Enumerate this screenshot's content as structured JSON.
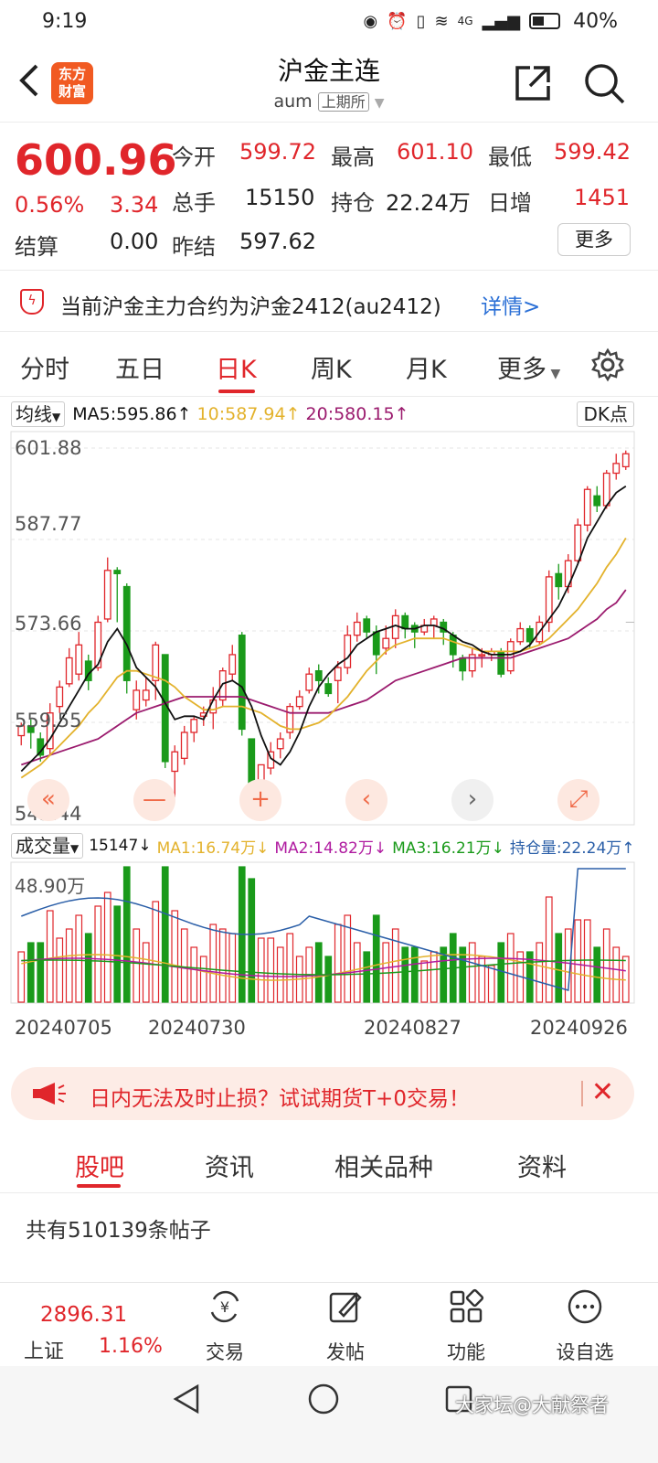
{
  "status": {
    "time": "9:19",
    "network": "4G",
    "battery": "40%"
  },
  "header": {
    "title": "沪金主连",
    "code": "aum",
    "exchange": "上期所",
    "logo_top": "东方",
    "logo_bottom": "财富"
  },
  "quote": {
    "price": "600.96",
    "change_pct": "0.56%",
    "change": "3.34",
    "settle_label": "结算",
    "settle": "0.00",
    "open_label": "今开",
    "open": "599.72",
    "high_label": "最高",
    "high": "601.10",
    "low_label": "最低",
    "low": "599.42",
    "volume_label": "总手",
    "volume": "15150",
    "oi_label": "持仓",
    "oi": "22.24万",
    "daily_inc_label": "日增",
    "daily_inc": "1451",
    "prev_settle_label": "昨结",
    "prev_settle": "597.62",
    "more_label": "更多"
  },
  "notice": {
    "text": "当前沪金主力合约为沪金2412(au2412)",
    "link": "详情>"
  },
  "tabs": [
    "分时",
    "五日",
    "日K",
    "周K",
    "月K",
    "更多"
  ],
  "ma": {
    "selector": "均线",
    "ma5": "MA5:595.86↑",
    "ma10": "10:587.94↑",
    "ma20": "20:580.15↑",
    "dk": "DK点"
  },
  "y_labels": [
    "601.88",
    "587.77",
    "573.66",
    "559.55",
    "545.44"
  ],
  "vol": {
    "selector": "成交量",
    "val": "15147↓",
    "ma1": "MA1:16.74万↓",
    "ma2": "MA2:14.82万↓",
    "ma3": "MA3:16.21万↓",
    "oi": "持仓量:22.24万↑",
    "max_label": "48.90万"
  },
  "dates": [
    "20240705",
    "20240730",
    "20240827",
    "20240926"
  ],
  "promo": {
    "text": "日内无法及时止损？试试期货T+0交易！"
  },
  "bottom_tabs": [
    "股吧",
    "资讯",
    "相关品种",
    "资料"
  ],
  "posts": "共有510139条帖子",
  "bottom_nav": {
    "index_value": "2896.31",
    "index_name": "上证",
    "index_pct": "1.16%",
    "items": [
      "交易",
      "发帖",
      "功能",
      "设自选"
    ]
  },
  "watermark": "大家坛@大献祭者",
  "colors": {
    "up": "#e0262b",
    "down": "#1a9a1a",
    "ma5": "#111111",
    "ma10": "#e3b22c",
    "ma20": "#9b1b6e",
    "oi_line": "#2b5fa8"
  },
  "chart_data": {
    "type": "candlestick",
    "ylim": [
      545.44,
      601.88
    ],
    "candles": [
      [
        557.5,
        559.0,
        556.0,
        559.5
      ],
      [
        559.0,
        558.0,
        555.5,
        560.0
      ],
      [
        557.0,
        554.5,
        553.5,
        558.0
      ],
      [
        555.5,
        561.0,
        554.5,
        562.5
      ],
      [
        562.0,
        565.0,
        561.0,
        566.0
      ],
      [
        565.5,
        569.5,
        565.0,
        571.0
      ],
      [
        567.0,
        571.5,
        566.0,
        573.5
      ],
      [
        569.0,
        566.0,
        564.5,
        570.0
      ],
      [
        568.0,
        575.0,
        567.5,
        576.0
      ],
      [
        575.5,
        583.0,
        575.0,
        585.0
      ],
      [
        583.0,
        582.5,
        575.0,
        583.5
      ],
      [
        580.5,
        566.0,
        564.0,
        581.0
      ],
      [
        561.5,
        564.5,
        560.0,
        566.0
      ],
      [
        563.0,
        564.5,
        562.0,
        566.5
      ],
      [
        566.0,
        571.5,
        563.0,
        572.0
      ],
      [
        570.0,
        553.5,
        552.5,
        570.0
      ],
      [
        552.0,
        555.0,
        548.0,
        556.0
      ],
      [
        554.0,
        558.0,
        553.0,
        559.0
      ],
      [
        558.0,
        560.0,
        556.5,
        560.5
      ],
      [
        560.5,
        561.0,
        559.0,
        562.0
      ],
      [
        561.0,
        563.0,
        558.5,
        565.0
      ],
      [
        563.0,
        567.5,
        562.0,
        568.0
      ],
      [
        567.0,
        570.0,
        566.0,
        571.5
      ],
      [
        573.0,
        558.5,
        557.5,
        573.5
      ],
      [
        557.0,
        548.0,
        545.5,
        557.0
      ],
      [
        548.5,
        553.0,
        548.0,
        553.0
      ],
      [
        552.5,
        555.0,
        551.5,
        556.5
      ],
      [
        555.5,
        557.0,
        554.0,
        558.0
      ],
      [
        558.0,
        562.0,
        557.0,
        562.5
      ],
      [
        562.0,
        563.5,
        561.5,
        564.5
      ],
      [
        564.5,
        567.0,
        564.0,
        568.0
      ],
      [
        567.5,
        566.0,
        564.0,
        568.5
      ],
      [
        565.5,
        564.0,
        563.5,
        566.5
      ],
      [
        566.0,
        568.0,
        562.5,
        569.0
      ],
      [
        568.0,
        573.0,
        567.0,
        574.5
      ],
      [
        573.0,
        575.0,
        572.0,
        576.5
      ],
      [
        575.5,
        573.5,
        572.5,
        576.0
      ],
      [
        573.5,
        570.0,
        567.0,
        574.5
      ],
      [
        571.0,
        572.5,
        570.0,
        574.5
      ],
      [
        572.5,
        576.0,
        571.0,
        577.0
      ],
      [
        576.0,
        574.0,
        572.5,
        576.5
      ],
      [
        574.5,
        573.5,
        571.0,
        575.0
      ],
      [
        573.5,
        574.5,
        573.0,
        575.5
      ],
      [
        574.5,
        575.5,
        572.5,
        576.0
      ],
      [
        575.0,
        573.5,
        571.5,
        575.5
      ],
      [
        573.0,
        570.0,
        568.0,
        573.5
      ],
      [
        569.5,
        567.5,
        566.0,
        570.0
      ],
      [
        567.5,
        570.0,
        566.5,
        571.0
      ],
      [
        570.0,
        570.0,
        568.0,
        571.0
      ],
      [
        570.0,
        570.5,
        569.0,
        571.0
      ],
      [
        570.5,
        567.0,
        566.5,
        571.0
      ],
      [
        567.5,
        572.0,
        567.0,
        572.5
      ],
      [
        572.0,
        574.0,
        571.5,
        575.0
      ],
      [
        574.0,
        572.0,
        571.0,
        574.5
      ],
      [
        572.0,
        575.0,
        571.5,
        576.0
      ],
      [
        575.0,
        582.0,
        573.5,
        583.0
      ],
      [
        582.5,
        580.5,
        578.5,
        584.0
      ],
      [
        580.5,
        584.5,
        579.5,
        585.5
      ],
      [
        584.5,
        590.0,
        584.0,
        591.0
      ],
      [
        590.0,
        595.5,
        589.0,
        596.0
      ],
      [
        594.5,
        593.0,
        592.0,
        596.0
      ],
      [
        593.0,
        598.0,
        592.5,
        598.5
      ],
      [
        598.0,
        599.5,
        597.0,
        601.0
      ],
      [
        599.0,
        601.0,
        598.5,
        601.5
      ]
    ],
    "ma5": [
      552,
      553.5,
      555,
      557,
      559.5,
      562,
      564.5,
      567,
      568.5,
      572,
      574,
      571.5,
      568,
      566.5,
      565,
      562.5,
      560,
      560.5,
      560.5,
      560,
      563,
      565.5,
      566,
      565,
      562,
      557.5,
      554,
      553,
      555,
      558,
      562,
      565,
      567,
      568.5,
      569.5,
      571.5,
      572.5,
      573.5,
      574,
      574.5,
      574,
      574,
      574.5,
      574.5,
      574,
      573,
      572,
      571.5,
      570.5,
      570,
      570,
      570,
      570.5,
      571.5,
      573.5,
      575.5,
      577.5,
      580.5,
      584,
      588,
      590.5,
      593,
      595,
      596
    ],
    "ma10": [
      551,
      552,
      553,
      554.5,
      556,
      557.5,
      559,
      561,
      562.5,
      564.5,
      566.5,
      567.5,
      567.5,
      567,
      566.5,
      566,
      565,
      563.5,
      562.5,
      561.5,
      561.5,
      562,
      562,
      562,
      561.5,
      561,
      560,
      559,
      558.5,
      558.5,
      559,
      559.5,
      560.5,
      562,
      563.5,
      565.5,
      567.5,
      569,
      570.5,
      571.5,
      572,
      572.5,
      572.5,
      572.5,
      572.5,
      572,
      571.5,
      571,
      570.5,
      570.5,
      570.5,
      570.5,
      570.5,
      571,
      571.5,
      572.5,
      574,
      575.5,
      577,
      579,
      581,
      583.5,
      585.5,
      588
    ],
    "ma20": [
      553,
      553.5,
      554,
      554.5,
      555,
      555.5,
      556,
      556.5,
      557,
      558,
      559,
      560,
      561,
      561.5,
      562,
      562.5,
      563,
      563.5,
      563.5,
      563.5,
      563.5,
      563.5,
      563.5,
      563.5,
      563,
      562.5,
      562,
      561.5,
      561,
      561,
      561,
      561,
      561,
      561.5,
      562,
      562.5,
      563,
      564,
      565,
      566,
      566.5,
      567,
      567.5,
      568,
      568.5,
      569,
      569.5,
      569.5,
      569.5,
      569.5,
      569.5,
      569.5,
      570,
      570.5,
      571,
      571.5,
      572,
      572.5,
      573.5,
      574.5,
      575.5,
      577,
      578,
      580
    ]
  }
}
